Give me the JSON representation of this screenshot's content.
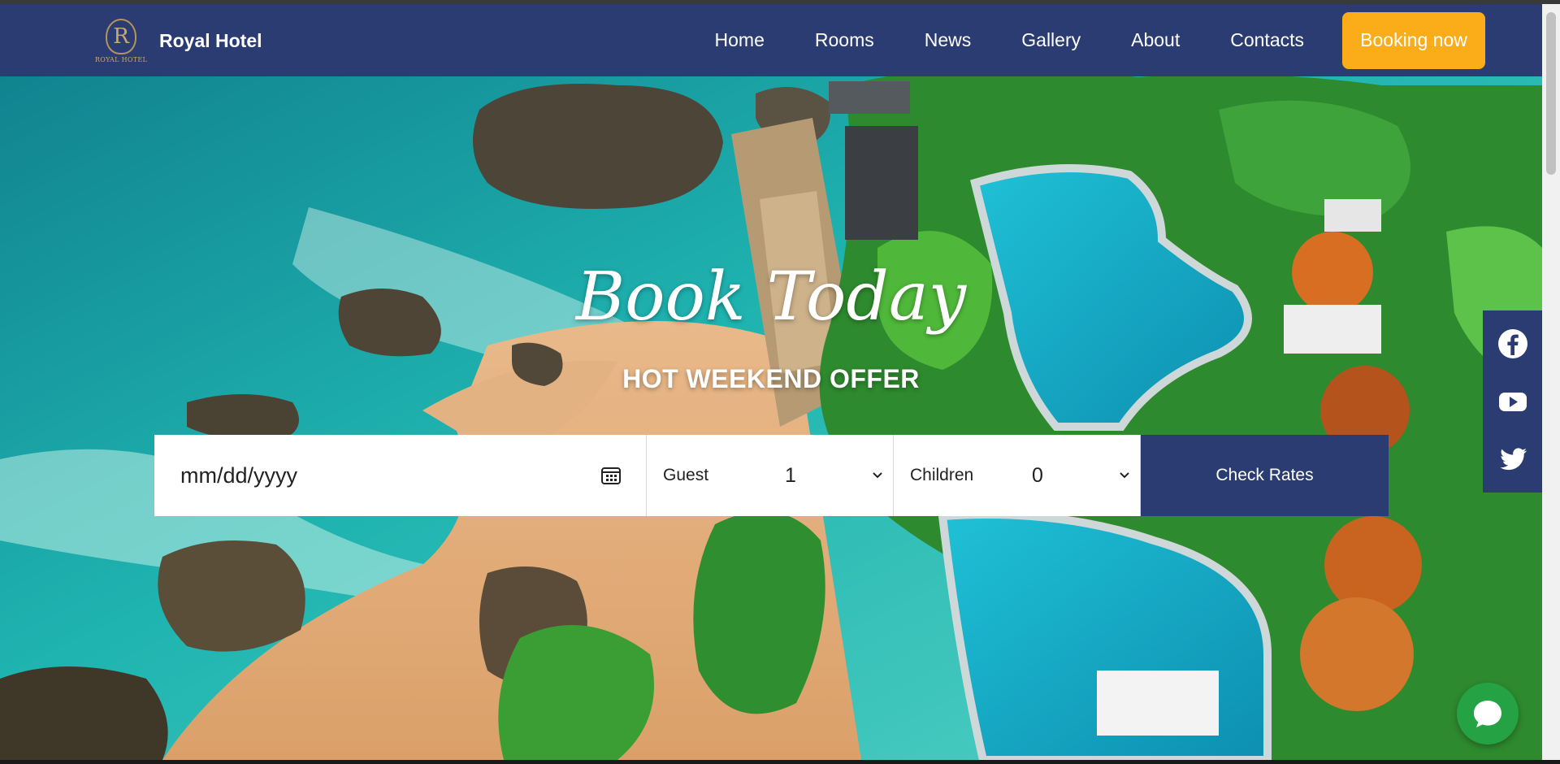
{
  "brand": {
    "name": "Royal Hotel",
    "logo_letter": "R",
    "logo_text": "ROYAL HOTEL"
  },
  "nav": {
    "items": [
      {
        "label": "Home"
      },
      {
        "label": "Rooms"
      },
      {
        "label": "News"
      },
      {
        "label": "Gallery"
      },
      {
        "label": "About"
      },
      {
        "label": "Contacts"
      }
    ],
    "booking_label": "Booking now"
  },
  "hero": {
    "headline": "Book Today",
    "subheadline": "HOT WEEKEND OFFER"
  },
  "booking_form": {
    "date_placeholder": "mm/dd/yyyy",
    "guest_label": "Guest",
    "guest_value": "1",
    "children_label": "Children",
    "children_value": "0",
    "submit_label": "Check Rates"
  },
  "social": {
    "icons": [
      "facebook-icon",
      "youtube-icon",
      "twitter-icon"
    ]
  },
  "chat": {
    "icon": "chat-bubble-icon"
  },
  "colors": {
    "primary": "#2b3c72",
    "accent": "#fbad19",
    "chat": "#25a244"
  }
}
